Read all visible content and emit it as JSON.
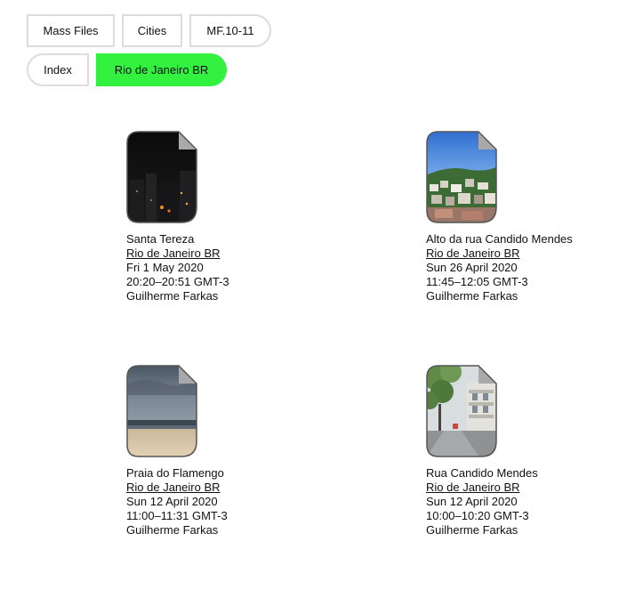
{
  "nav": {
    "row1": [
      {
        "label": "Mass Files"
      },
      {
        "label": "Cities"
      },
      {
        "label": "MF.10-11"
      }
    ],
    "row2": [
      {
        "label": "Index"
      },
      {
        "label": "Rio de Janeiro BR"
      }
    ],
    "active_color": "#33f23f"
  },
  "files": [
    {
      "title": "Santa Tereza",
      "city_link": "Rio de Janeiro BR",
      "date": "Fri 1 May 2020",
      "time": "20:20–20:51 GMT-3",
      "author": "Guilherme Farkas",
      "thumbnail": "night-city-thumbnail"
    },
    {
      "title": "Alto da rua Candido Mendes",
      "city_link": "Rio de Janeiro BR",
      "date": "Sun 26 April 2020",
      "time": "11:45–12:05 GMT-3",
      "author": "Guilherme Farkas",
      "thumbnail": "hillside-favela-thumbnail"
    },
    {
      "title": "Praia do Flamengo",
      "city_link": "Rio de Janeiro BR",
      "date": "Sun 12 April 2020",
      "time": "11:00–11:31 GMT-3",
      "author": "Guilherme Farkas",
      "thumbnail": "beach-storm-thumbnail"
    },
    {
      "title": "Rua Candido Mendes",
      "city_link": "Rio de Janeiro BR",
      "date": "Sun 12 April 2020",
      "time": "10:00–10:20 GMT-3",
      "author": "Guilherme Farkas",
      "thumbnail": "street-trees-thumbnail"
    }
  ]
}
